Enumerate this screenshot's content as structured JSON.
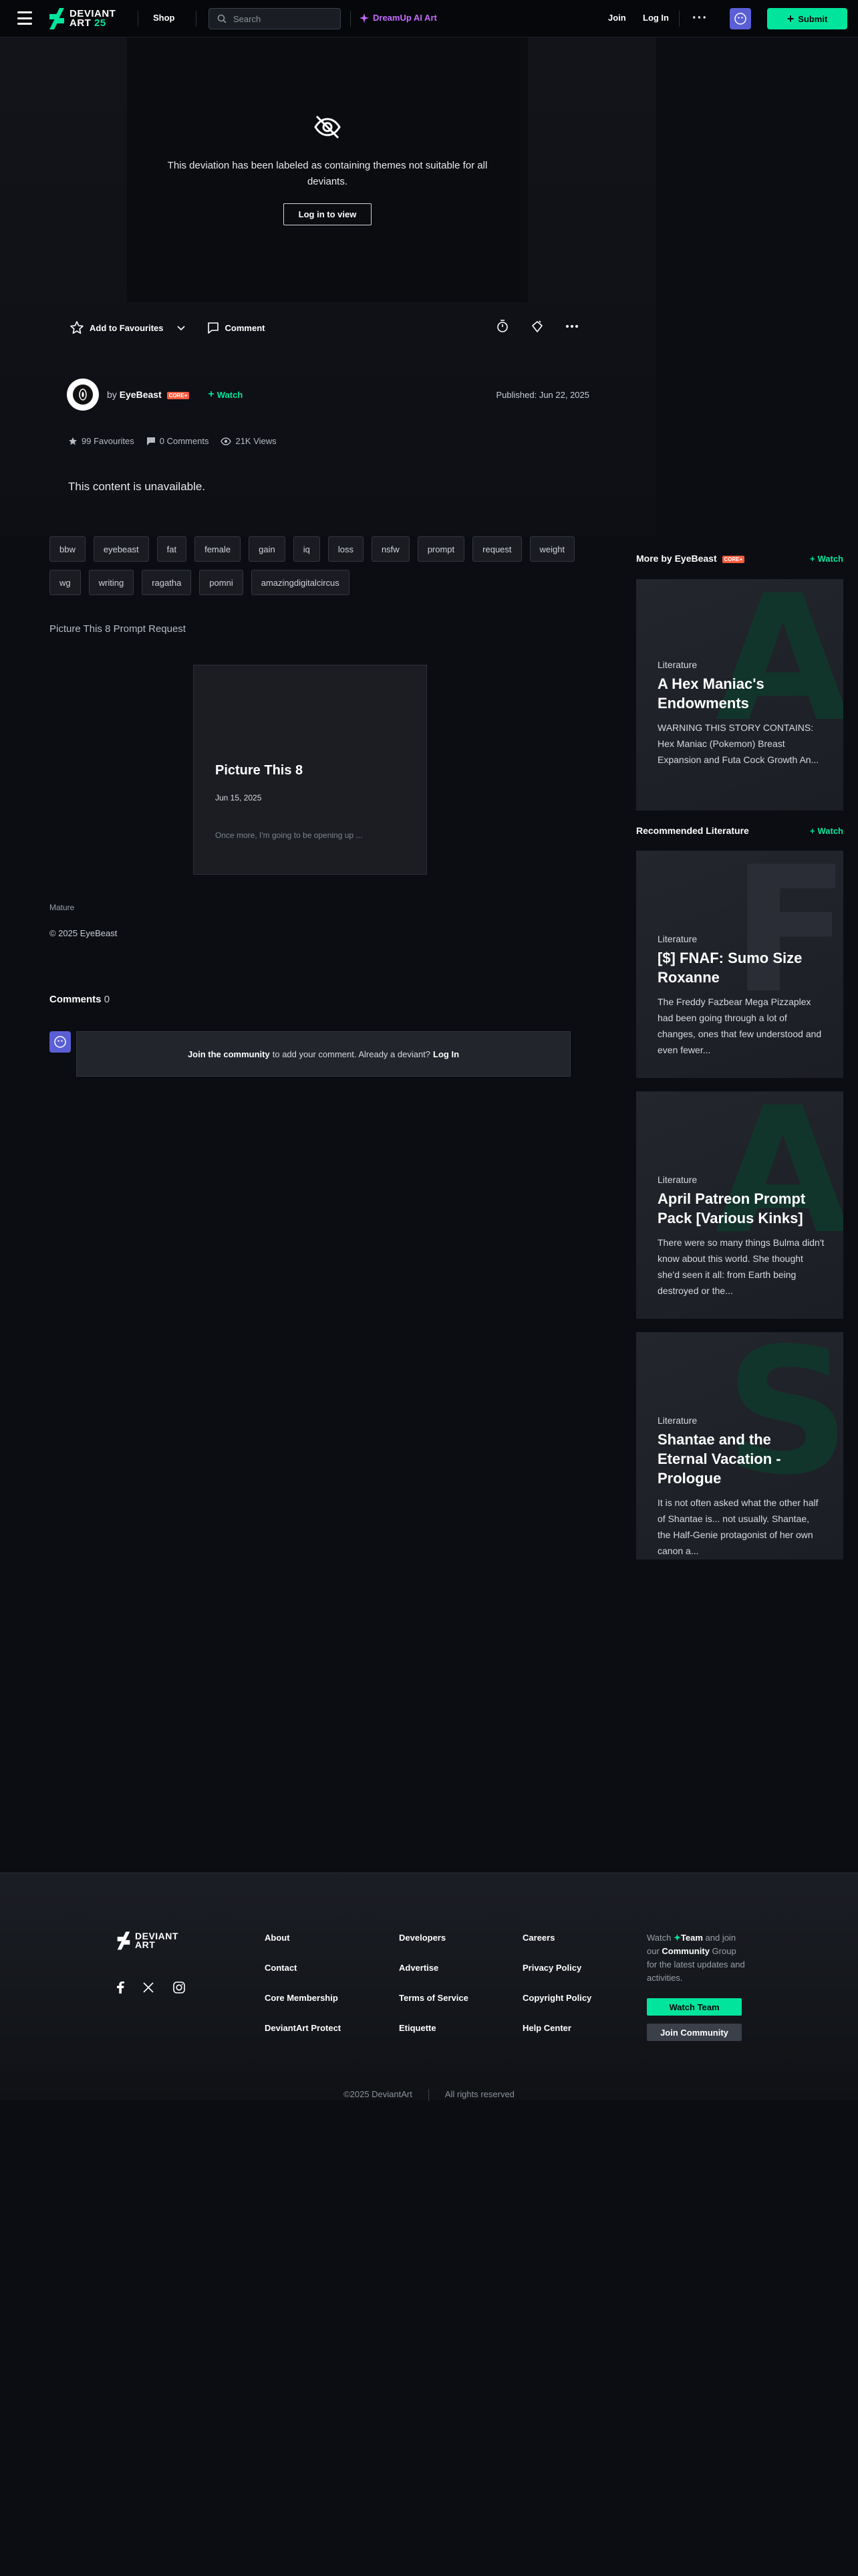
{
  "header": {
    "logo_line1": "DEVIANT",
    "logo_line2": "ART",
    "logo_age": "25",
    "shop": "Shop",
    "search_placeholder": "Search",
    "dreamup": "DreamUp AI Art",
    "join": "Join",
    "login": "Log In",
    "submit": "Submit",
    "accent": "#00e59b"
  },
  "deviation": {
    "mature_message": "This deviation has been labeled as containing themes not suitable for all deviants.",
    "login_to_view": "Log in to view",
    "add_favourites": "Add to Favourites",
    "comment": "Comment",
    "by": "by",
    "author": "EyeBeast",
    "core_badge": "CORE+",
    "watch": "Watch",
    "published": "Published: Jun 22, 2025",
    "favourites": "99 Favourites",
    "comments_count": "0 Comments",
    "views": "21K Views",
    "unavailable": "This content is unavailable."
  },
  "tags": [
    "bbw",
    "eyebeast",
    "fat",
    "female",
    "gain",
    "iq",
    "loss",
    "nsfw",
    "prompt",
    "request",
    "weight",
    "wg",
    "writing",
    "ragatha",
    "pomni",
    "amazingdigitalcircus"
  ],
  "description": {
    "title": "Picture This 8 Prompt Request",
    "card_title": "Picture This 8",
    "card_date": "Jun 15, 2025",
    "card_excerpt": "Once more, I'm going to be opening up ..."
  },
  "meta": {
    "mature": "Mature",
    "copyright": "© 2025 EyeBeast"
  },
  "comments": {
    "label": "Comments",
    "count": "0",
    "join_community": "Join the community",
    "prompt": "to add your comment. Already a deviant?",
    "login": "Log In"
  },
  "sidebar": {
    "more_by": "More by EyeBeast",
    "core_badge": "CORE+",
    "watch": "Watch",
    "recommended": "Recommended Literature",
    "more_cards": [
      {
        "kind": "Literature",
        "title": "A Hex Maniac's Endowments",
        "excerpt": "WARNING THIS STORY CONTAINS: Hex Maniac (Pokemon) Breast Expansion and Futa Cock Growth           An...",
        "letter": "A",
        "color": "#12352b"
      }
    ],
    "rec_cards": [
      {
        "kind": "Literature",
        "title": "[$] FNAF: Sumo Size Roxanne",
        "excerpt": "The Freddy Fazbear Mega Pizzaplex had been going through a lot of changes, ones that few understood and even fewer...",
        "letter": "F",
        "color": "#2a2d35"
      },
      {
        "kind": "Literature",
        "title": "April Patreon Prompt Pack [Various Kinks]",
        "excerpt": "There were so many things Bulma didn't know about this world. She thought she'd seen it all: from Earth being destroyed or the...",
        "letter": "A",
        "color": "#12352b"
      },
      {
        "kind": "Literature",
        "title": "Shantae and the Eternal Vacation - Prologue",
        "excerpt": "It is not often asked what the other half of Shantae is... not usually.  Shantae, the Half-Genie protagonist of her own canon a...",
        "letter": "S",
        "color": "#12352b"
      }
    ]
  },
  "footer": {
    "col1": [
      "About",
      "Contact",
      "Core Membership",
      "DeviantArt Protect"
    ],
    "col2": [
      "Developers",
      "Advertise",
      "Terms of Service",
      "Etiquette"
    ],
    "col3": [
      "Careers",
      "Privacy Policy",
      "Copyright Policy",
      "Help Center"
    ],
    "watch_text_1": "Watch",
    "team": "Team",
    "watch_text_2": "and join our",
    "community": "Community",
    "watch_text_3": "Group for the latest updates and activities.",
    "watch_team_btn": "Watch Team",
    "join_community_btn": "Join Community",
    "copyright": "©2025 DeviantArt",
    "rights": "All rights reserved"
  }
}
